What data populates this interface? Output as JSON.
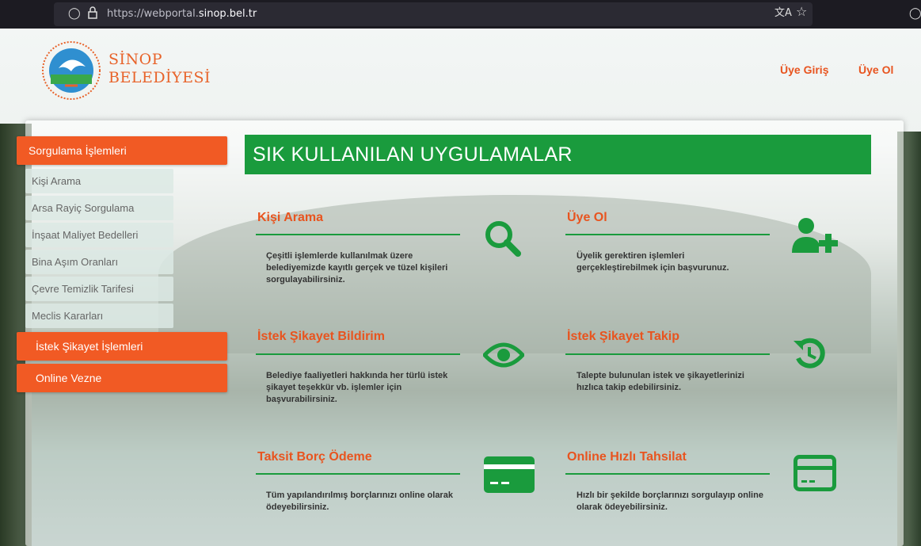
{
  "browser": {
    "url_prefix": "https://webportal.",
    "url_domain": "sinop.bel.tr"
  },
  "header": {
    "logo_line1": "SİNOP",
    "logo_line2": "BELEDİYESİ",
    "login": "Üye Giriş",
    "register": "Üye Ol"
  },
  "sidebar": {
    "section1": "Sorgulama İşlemleri",
    "items": [
      "Kişi Arama",
      "Arsa Rayiç Sorgulama",
      "İnşaat Maliyet Bedelleri",
      "Bina Aşım Oranları",
      "Çevre Temizlik Tarifesi",
      "Meclis Kararları"
    ],
    "section2": "İstek Şikayet İşlemleri",
    "section3": "Online Vezne"
  },
  "main": {
    "title": "SIK KULLANILAN UYGULAMALAR",
    "cards": [
      {
        "title": "Kişi Arama",
        "desc": "Çeşitli işlemlerde kullanılmak üzere belediyemizde kayıtlı gerçek ve tüzel kişileri sorgulayabilirsiniz.",
        "icon": "search-icon"
      },
      {
        "title": "Üye Ol",
        "desc": "Üyelik gerektiren işlemleri gerçekleştirebilmek için başvurunuz.",
        "icon": "user-plus-icon"
      },
      {
        "title": "İstek Şikayet Bildirim",
        "desc": "Belediye faaliyetleri hakkında her türlü istek şikayet teşekkür vb. işlemler için başvurabilirsiniz.",
        "icon": "eye-icon"
      },
      {
        "title": "İstek Şikayet Takip",
        "desc": "Talepte bulunulan istek ve şikayetlerinizi hızlıca takip edebilirsiniz.",
        "icon": "history-icon"
      },
      {
        "title": "Taksit Borç Ödeme",
        "desc": "Tüm yapılandırılmış borçlarınızı online olarak ödeyebilirsiniz.",
        "icon": "credit-card-icon"
      },
      {
        "title": "Online Hızlı Tahsilat",
        "desc": "Hızlı bir şekilde borçlarınızı sorgulayıp online olarak ödeyebilirsiniz.",
        "icon": "credit-card-outline-icon"
      }
    ]
  },
  "colors": {
    "accent_orange": "#f15a24",
    "accent_green": "#1a9b3d"
  }
}
